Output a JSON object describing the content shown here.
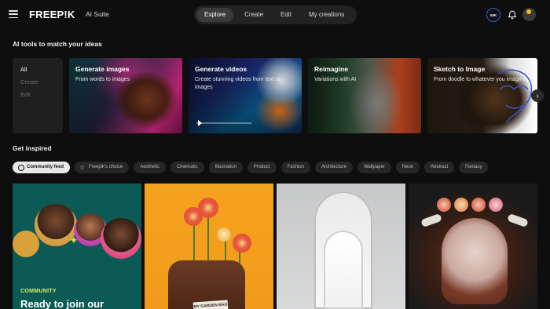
{
  "header": {
    "logo": "FREEP!K",
    "suite": "AI Suite",
    "tabs": [
      {
        "label": "Explore",
        "active": true
      },
      {
        "label": "Create",
        "active": false
      },
      {
        "label": "Edit",
        "active": false
      },
      {
        "label": "My creations",
        "active": false
      }
    ],
    "badge_text": "50K",
    "icons": [
      "menu-icon",
      "bell-icon",
      "avatar"
    ]
  },
  "tools": {
    "title": "AI tools to match your ideas",
    "filters": [
      "All",
      "Create",
      "Edit"
    ],
    "cards": [
      {
        "title": "Generate images",
        "subtitle": "From words to images"
      },
      {
        "title": "Generate videos",
        "subtitle": "Create stunning videos from text or images"
      },
      {
        "title": "Reimagine",
        "subtitle": "Variations with AI"
      },
      {
        "title": "Sketch to Image",
        "subtitle": "From doodle to whatever you imagine"
      }
    ]
  },
  "inspired": {
    "title": "Get inspired",
    "chips": [
      {
        "label": "Community feed",
        "active": true
      },
      {
        "label": "Freepik's choice",
        "active": false
      },
      {
        "label": "Aesthetic",
        "active": false
      },
      {
        "label": "Cinematic",
        "active": false
      },
      {
        "label": "Illustration",
        "active": false
      },
      {
        "label": "Product",
        "active": false
      },
      {
        "label": "Fashion",
        "active": false
      },
      {
        "label": "Architecture",
        "active": false
      },
      {
        "label": "Wallpaper",
        "active": false
      },
      {
        "label": "Neon",
        "active": false
      },
      {
        "label": "Abstract",
        "active": false
      },
      {
        "label": "Fantasy",
        "active": false
      }
    ],
    "feed": {
      "community_label": "COMMUNITY",
      "community_heading": "Ready to join our",
      "bag_label": "MY GARDEN BAG"
    }
  },
  "colors": {
    "background": "#0e0e0e",
    "accent_community": "#d6f16a",
    "badge_ring": "#2f5bd8",
    "avatar_dot": "#f0c21b"
  }
}
